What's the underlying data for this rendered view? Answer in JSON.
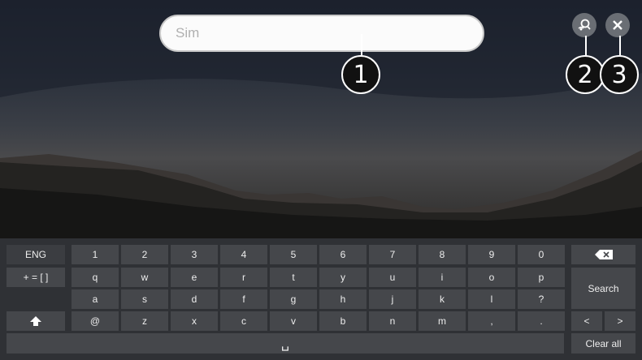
{
  "search": {
    "placeholder": "Sim"
  },
  "callouts": [
    "1",
    "2",
    "3"
  ],
  "buttons": {
    "voice_search_icon": "voice-search-icon",
    "close_icon": "close-icon"
  },
  "keyboard": {
    "lang_label": "ENG",
    "symbols_label": "+ = [ ]",
    "row1": [
      "1",
      "2",
      "3",
      "4",
      "5",
      "6",
      "7",
      "8",
      "9",
      "0"
    ],
    "row2": [
      "q",
      "w",
      "e",
      "r",
      "t",
      "y",
      "u",
      "i",
      "o",
      "p"
    ],
    "row3": [
      "a",
      "s",
      "d",
      "f",
      "g",
      "h",
      "j",
      "k",
      "l",
      "?"
    ],
    "row4": [
      "@",
      "z",
      "x",
      "c",
      "v",
      "b",
      "n",
      "m",
      ",",
      "."
    ],
    "space_label": "␣",
    "search_label": "Search",
    "left_label": "<",
    "right_label": ">",
    "clear_label": "Clear all"
  }
}
